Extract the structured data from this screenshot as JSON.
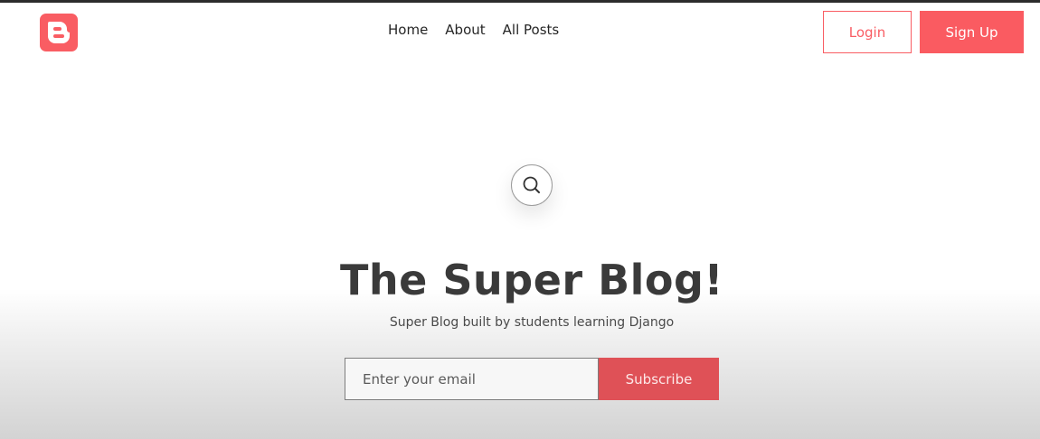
{
  "header": {
    "logo_icon": "blogger-b-icon",
    "nav": [
      {
        "label": "Home"
      },
      {
        "label": "About"
      },
      {
        "label": "All Posts"
      }
    ],
    "login_label": "Login",
    "signup_label": "Sign Up"
  },
  "hero": {
    "search_icon": "search-icon",
    "title": "The Super Blog!",
    "subtitle": "Super Blog built by students learning Django"
  },
  "subscribe": {
    "email_placeholder": "Enter your email",
    "email_value": "",
    "button_label": "Subscribe"
  },
  "colors": {
    "accent": "#f95d63",
    "subscribe_button": "#df5157",
    "text_dark": "#3a3a3a"
  }
}
